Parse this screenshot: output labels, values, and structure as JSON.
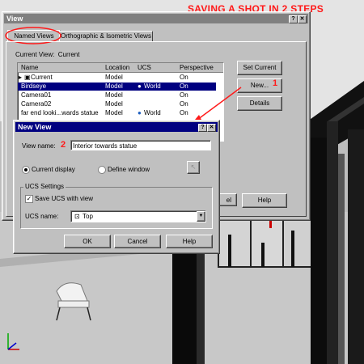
{
  "caption": "SAVING A SHOT IN 2 STEPS",
  "view_dialog": {
    "title": "View",
    "tabs": [
      "Named Views",
      "Orthographic & Isometric Views"
    ],
    "current_view_label": "Current View:",
    "current_view_value": "Current",
    "columns": [
      "Name",
      "Location",
      "UCS",
      "Perspective"
    ],
    "rows": [
      {
        "name": "Current",
        "location": "Model",
        "ucs": "",
        "perspective": "On"
      },
      {
        "name": "Birdseye",
        "location": "Model",
        "ucs": "World",
        "perspective": "On"
      },
      {
        "name": "Camera01",
        "location": "Model",
        "ucs": "",
        "perspective": "On"
      },
      {
        "name": "Camera02",
        "location": "Model",
        "ucs": "",
        "perspective": "On"
      },
      {
        "name": "far end looki...wards statue",
        "location": "Model",
        "ucs": "World",
        "perspective": "On"
      }
    ],
    "buttons": {
      "set_current": "Set Current",
      "new": "New...",
      "details": "Details",
      "cancel_partial": "el",
      "help": "Help"
    },
    "step1": "1"
  },
  "new_view_dialog": {
    "title": "New View",
    "view_name_label": "View name:",
    "view_name_value": "Interior towards statue",
    "step2": "2",
    "current_display": "Current display",
    "define_window": "Define window",
    "ucs_group": "UCS Settings",
    "save_ucs": "Save UCS with view",
    "ucs_name_label": "UCS name:",
    "ucs_name_value": "Top",
    "ok": "OK",
    "cancel": "Cancel",
    "help": "Help"
  },
  "colors": {
    "title_active": "#000080",
    "annotation": "#ff1a1a"
  }
}
